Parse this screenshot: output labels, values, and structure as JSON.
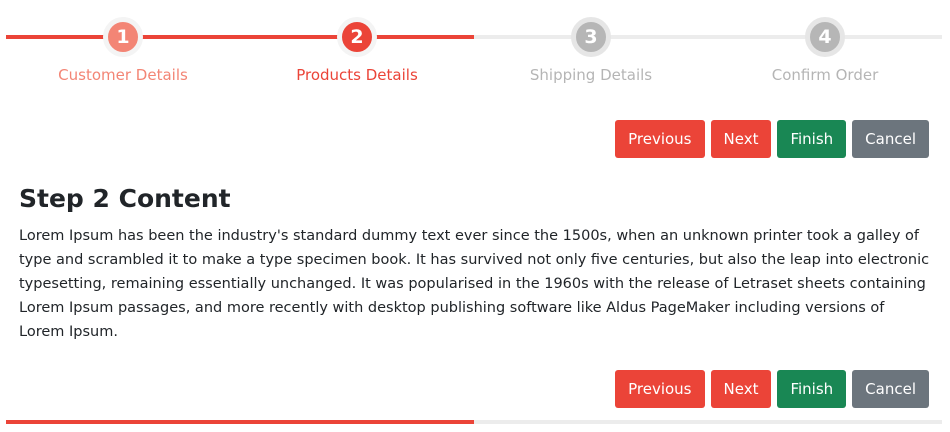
{
  "stepper": {
    "steps": [
      {
        "number": "1",
        "label": "Customer Details",
        "state": "done"
      },
      {
        "number": "2",
        "label": "Products Details",
        "state": "active"
      },
      {
        "number": "3",
        "label": "Shipping Details",
        "state": "pending"
      },
      {
        "number": "4",
        "label": "Confirm Order",
        "state": "pending"
      }
    ],
    "progress_fraction": 0.5
  },
  "toolbar": {
    "previous_label": "Previous",
    "next_label": "Next",
    "finish_label": "Finish",
    "cancel_label": "Cancel"
  },
  "content": {
    "title": "Step 2 Content",
    "body": "Lorem Ipsum has been the industry's standard dummy text ever since the 1500s, when an unknown printer took a galley of type and scrambled it to make a type specimen book. It has survived not only five centuries, but also the leap into electronic typesetting, remaining essentially unchanged. It was popularised in the 1960s with the release of Letraset sheets containing Lorem Ipsum passages, and more recently with desktop publishing software like Aldus PageMaker including versions of Lorem Ipsum."
  },
  "colors": {
    "accent": "#eb4438",
    "done": "#f38575",
    "pending": "#b6b6b6",
    "finish": "#198754",
    "cancel": "#6c757d"
  }
}
